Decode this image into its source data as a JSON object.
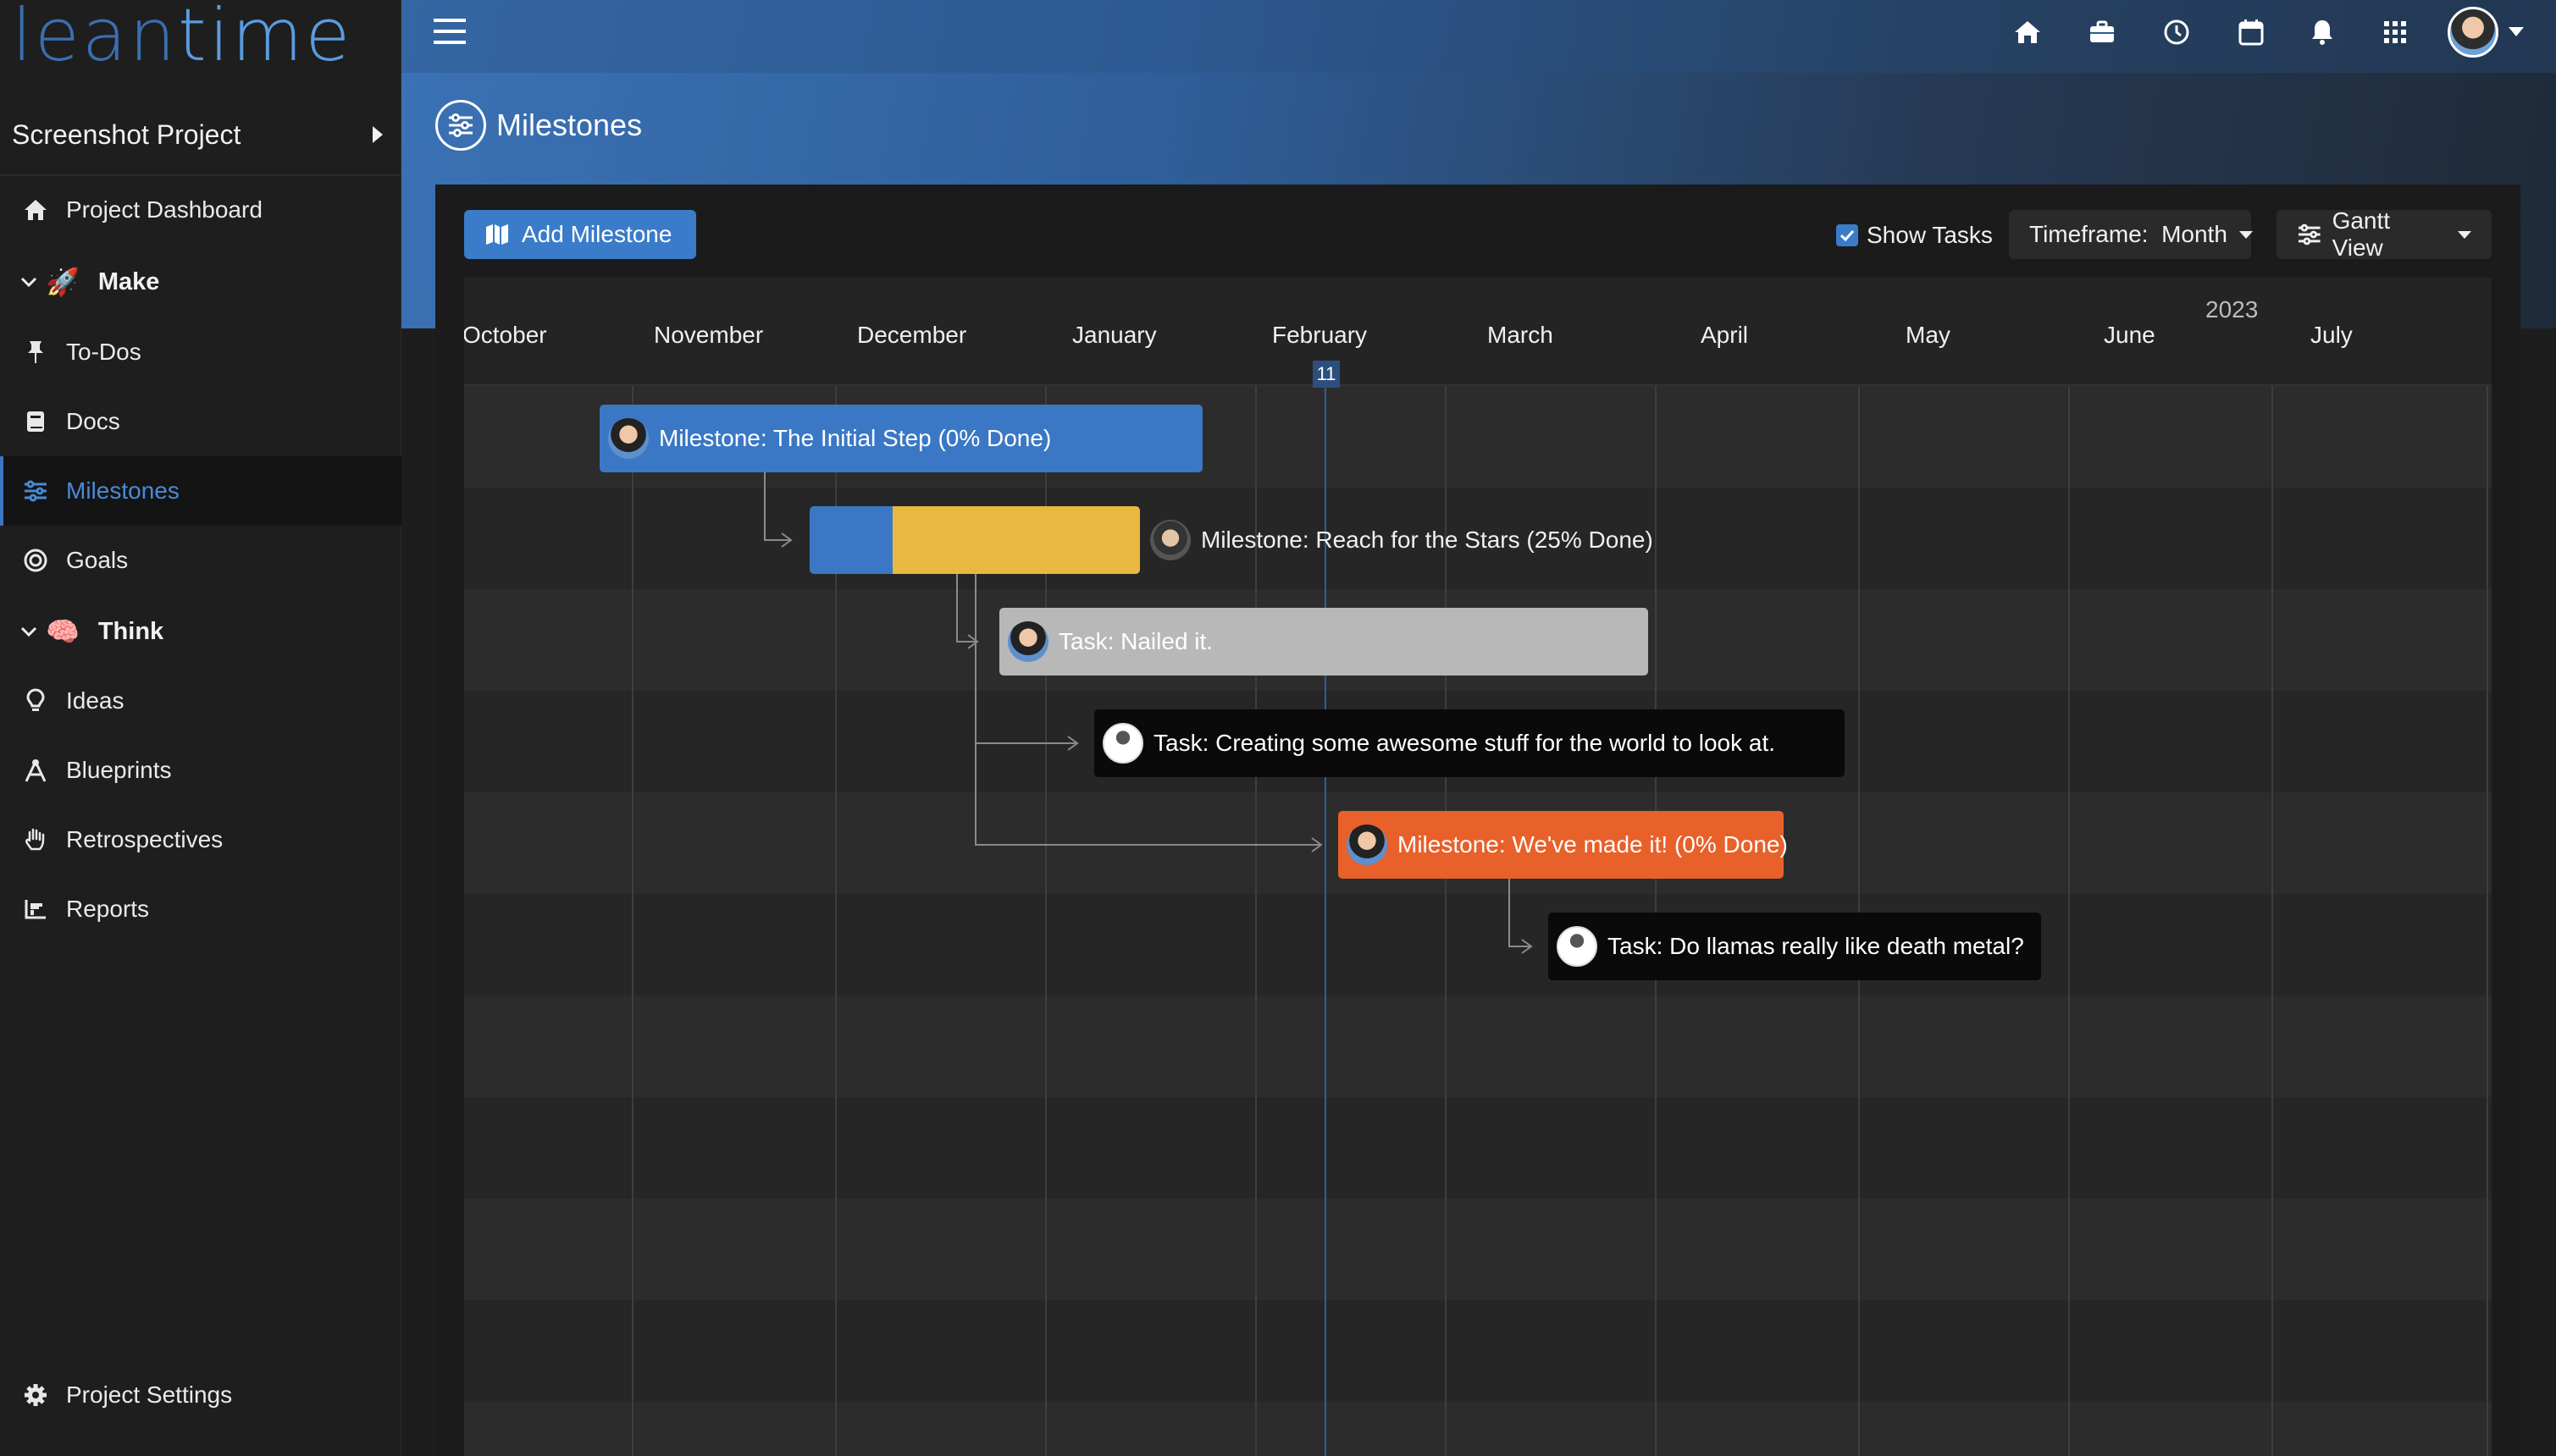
{
  "sidebar": {
    "logo_lean": "lean",
    "logo_time": "time",
    "project": "Screenshot Project",
    "items": {
      "dashboard": "Project Dashboard",
      "make": "Make",
      "todos": "To-Dos",
      "docs": "Docs",
      "milestones": "Milestones",
      "goals": "Goals",
      "think": "Think",
      "ideas": "Ideas",
      "blueprints": "Blueprints",
      "retrospectives": "Retrospectives",
      "reports": "Reports",
      "settings": "Project Settings"
    },
    "emoji": {
      "make": "🚀",
      "think": "🧠"
    }
  },
  "page": {
    "title": "Milestones"
  },
  "toolbar": {
    "add_milestone": "Add Milestone",
    "show_tasks": "Show Tasks",
    "show_tasks_checked": true,
    "timeframe": "Timeframe:  Month",
    "view": "Gantt View"
  },
  "gantt": {
    "year": "2023",
    "months": [
      "October",
      "November",
      "December",
      "January",
      "February",
      "March",
      "April",
      "May",
      "June",
      "July"
    ],
    "today": "11",
    "items": {
      "initial": "Milestone: The Initial Step (0% Done)",
      "stars": "Milestone: Reach for the Stars (25% Done)",
      "nailed": "Task: Nailed it.",
      "awesome": "Task: Creating some awesome stuff for the world to look at.",
      "made_it": "Milestone: We've made it! (0% Done)",
      "llamas": "Task: Do llamas really like death metal?"
    },
    "stars_progress": 0.25
  },
  "colors": {
    "accent": "#3a78c5",
    "milestone_yellow": "#e9b840",
    "milestone_orange": "#e8602a",
    "task_gray": "#b8b8b8",
    "task_black": "#0a0a0a"
  }
}
